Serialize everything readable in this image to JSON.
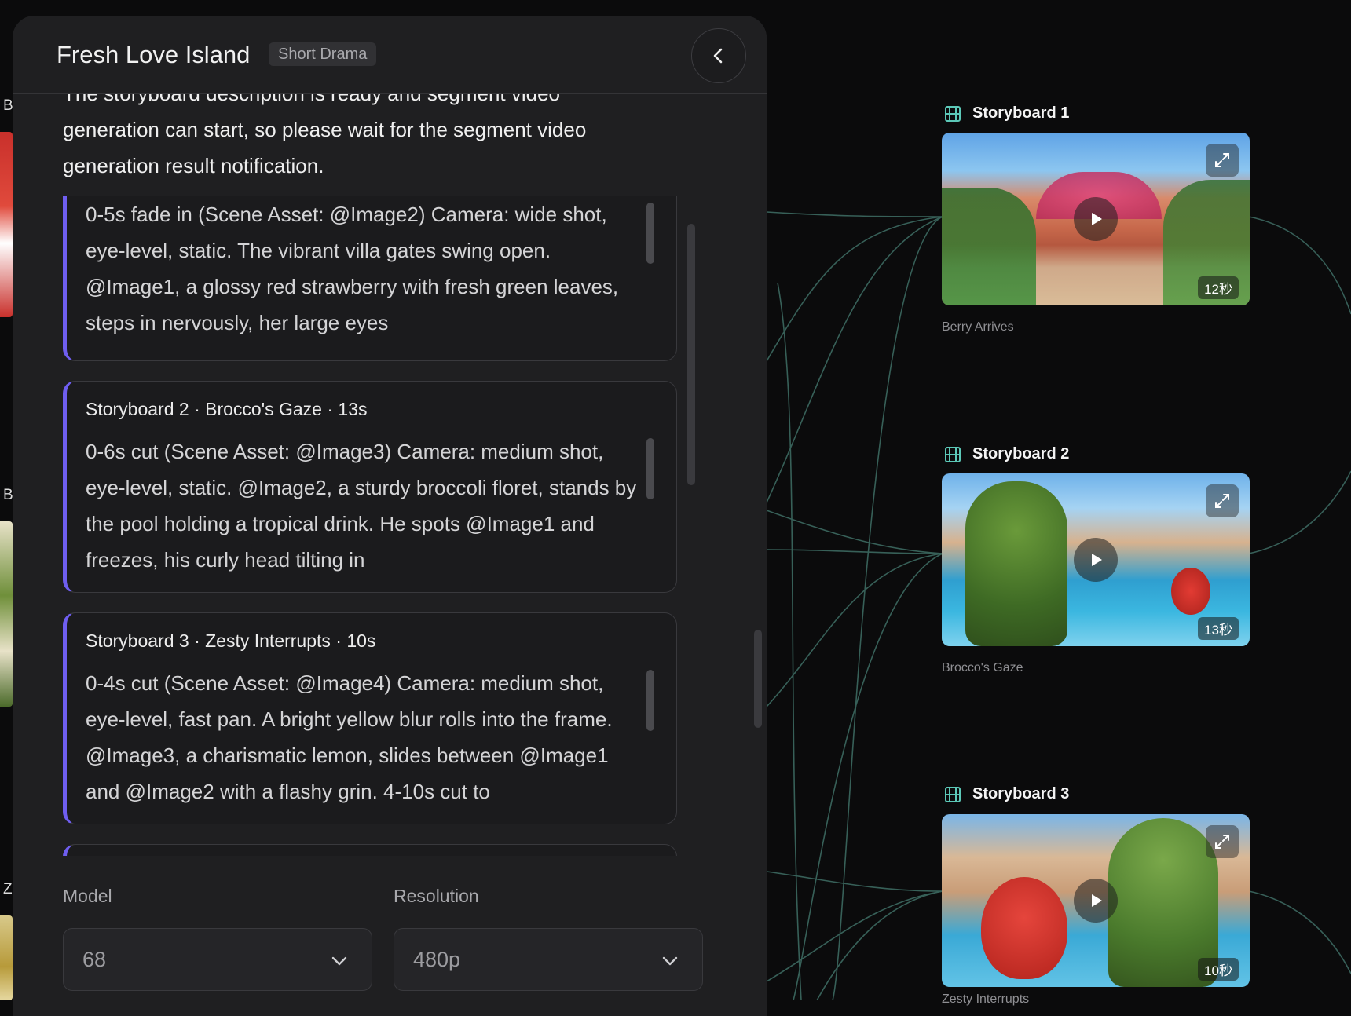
{
  "header": {
    "title": "Fresh Love Island",
    "tag": "Short Drama"
  },
  "intro_text": "The storyboard description is ready and segment video generation can start, so please wait for the segment video generation result notification.",
  "cards": [
    {
      "heading": "",
      "body": "0-5s fade in (Scene Asset: @Image2) Camera: wide shot, eye-level, static. The vibrant villa gates swing open. @Image1, a glossy red strawberry with fresh green leaves, steps in nervously, her large eyes"
    },
    {
      "heading": "Storyboard 2 · Brocco's Gaze · 13s",
      "body": "0-6s cut (Scene Asset: @Image3) Camera: medium shot, eye-level, static. @Image2, a sturdy broccoli floret, stands by the pool holding a tropical drink. He spots @Image1 and freezes, his curly head tilting in"
    },
    {
      "heading": "Storyboard 3 · Zesty Interrupts · 10s",
      "body": "0-4s cut (Scene Asset: @Image4) Camera: medium shot, eye-level, fast pan. A bright yellow blur rolls into the frame. @Image3, a charismatic lemon, slides between @Image1 and @Image2 with a flashy grin. 4-10s cut to"
    }
  ],
  "footer": {
    "model_label": "Model",
    "model_value": "68",
    "resolution_label": "Resolution",
    "resolution_value": "480p"
  },
  "storyboards": [
    {
      "title": "Storyboard 1",
      "duration": "12秒",
      "caption": "Berry Arrives"
    },
    {
      "title": "Storyboard 2",
      "duration": "13秒",
      "caption": "Brocco's Gaze"
    },
    {
      "title": "Storyboard 3",
      "duration": "10秒",
      "caption": "Zesty Interrupts"
    }
  ],
  "left_strip_letters": [
    "B",
    "B",
    "Z"
  ],
  "colors": {
    "accent": "#6f5ef0",
    "panel_bg": "#1f1f21",
    "canvas_bg": "#0b0b0c",
    "connector": "#3f6f66",
    "film_icon": "#5cc8b8"
  },
  "icons": {
    "back": "chevron-left-icon",
    "select": "chevron-down-icon",
    "storyboard": "film-icon",
    "play": "play-icon",
    "expand": "expand-icon"
  }
}
